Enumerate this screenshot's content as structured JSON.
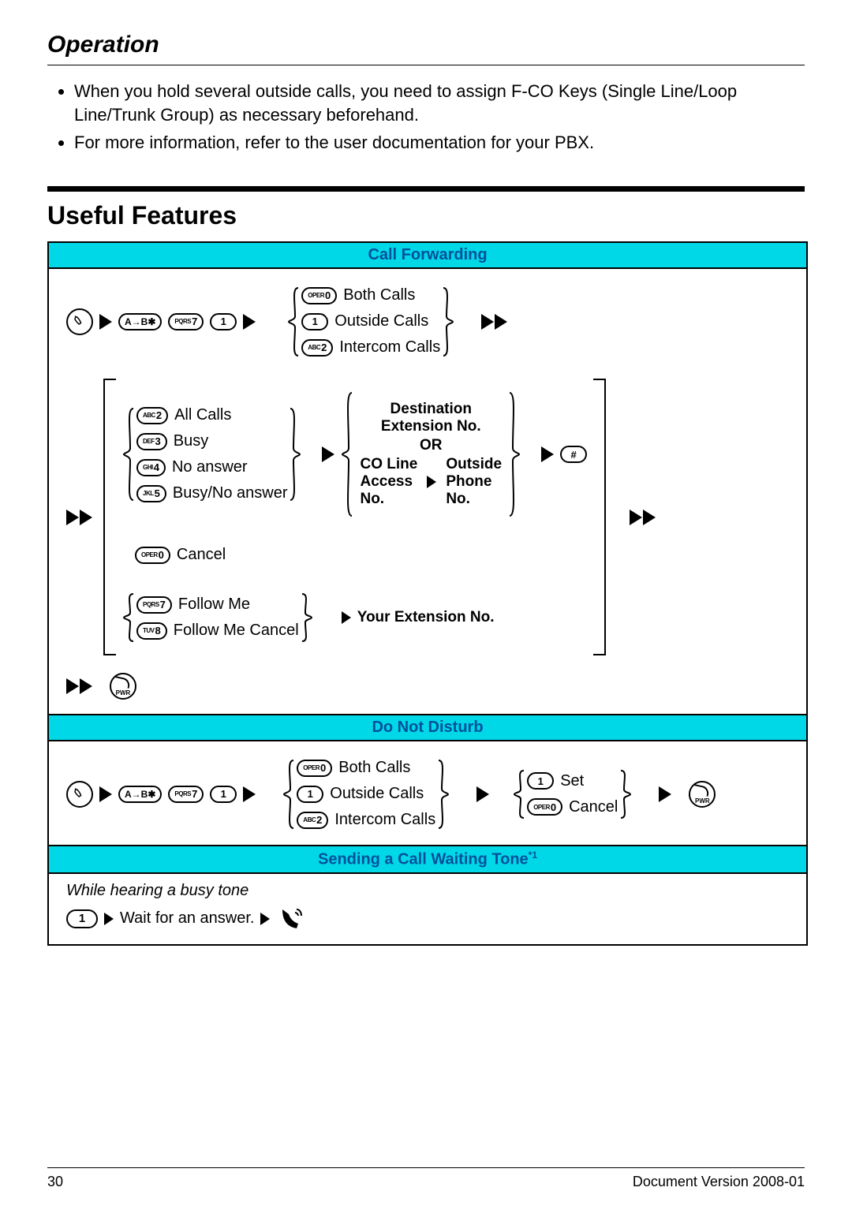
{
  "header": {
    "section_title": "Operation"
  },
  "bullets": [
    "When you hold several outside calls, you need to assign F-CO Keys (Single Line/Loop Line/Trunk Group) as necessary beforehand.",
    "For more information, refer to the user documentation for your PBX."
  ],
  "useful_features_title": "Useful Features",
  "features": {
    "call_forwarding": {
      "title": "Call Forwarding",
      "initial_keys": {
        "star": "A→B✱",
        "seven": {
          "sub": "PQRS",
          "main": "7"
        },
        "one": "1"
      },
      "call_type_options": [
        {
          "key_sub": "OPER",
          "key_main": "0",
          "label": "Both Calls"
        },
        {
          "key_sub": "",
          "key_main": "1",
          "label": "Outside Calls"
        },
        {
          "key_sub": "ABC",
          "key_main": "2",
          "label": "Intercom Calls"
        }
      ],
      "mode_options_group1": [
        {
          "key_sub": "ABC",
          "key_main": "2",
          "label": "All Calls"
        },
        {
          "key_sub": "DEF",
          "key_main": "3",
          "label": "Busy"
        },
        {
          "key_sub": "GHI",
          "key_main": "4",
          "label": "No answer"
        },
        {
          "key_sub": "JKL",
          "key_main": "5",
          "label": "Busy/No answer"
        }
      ],
      "destination_block": {
        "top_label": "Destination\nExtension No.",
        "or": "OR",
        "co": "CO Line\nAccess\nNo.",
        "phone": "Outside\nPhone\nNo."
      },
      "hash_key": "#",
      "cancel_line": {
        "key_sub": "OPER",
        "key_main": "0",
        "label": "Cancel"
      },
      "follow_me_lines": [
        {
          "key_sub": "PQRS",
          "key_main": "7",
          "label": "Follow Me"
        },
        {
          "key_sub": "TUV",
          "key_main": "8",
          "label": "Follow Me Cancel"
        }
      ],
      "your_ext": "Your Extension No."
    },
    "dnd": {
      "title": "Do Not Disturb",
      "initial_keys": {
        "star": "A→B✱",
        "seven": {
          "sub": "PQRS",
          "main": "7"
        },
        "one": "1"
      },
      "call_type_options": [
        {
          "key_sub": "OPER",
          "key_main": "0",
          "label": "Both Calls"
        },
        {
          "key_sub": "",
          "key_main": "1",
          "label": "Outside Calls"
        },
        {
          "key_sub": "ABC",
          "key_main": "2",
          "label": "Intercom Calls"
        }
      ],
      "set_cancel": [
        {
          "key_sub": "",
          "key_main": "1",
          "label": "Set"
        },
        {
          "key_sub": "OPER",
          "key_main": "0",
          "label": "Cancel"
        }
      ]
    },
    "waiting_tone": {
      "title": "Sending a Call Waiting Tone",
      "sup": "*1",
      "note": "While hearing a busy tone",
      "one": "1",
      "wait": "Wait for an answer."
    }
  },
  "icons": {
    "pwr_label": "PWR"
  },
  "footer": {
    "page": "30",
    "version": "Document Version  2008-01"
  }
}
